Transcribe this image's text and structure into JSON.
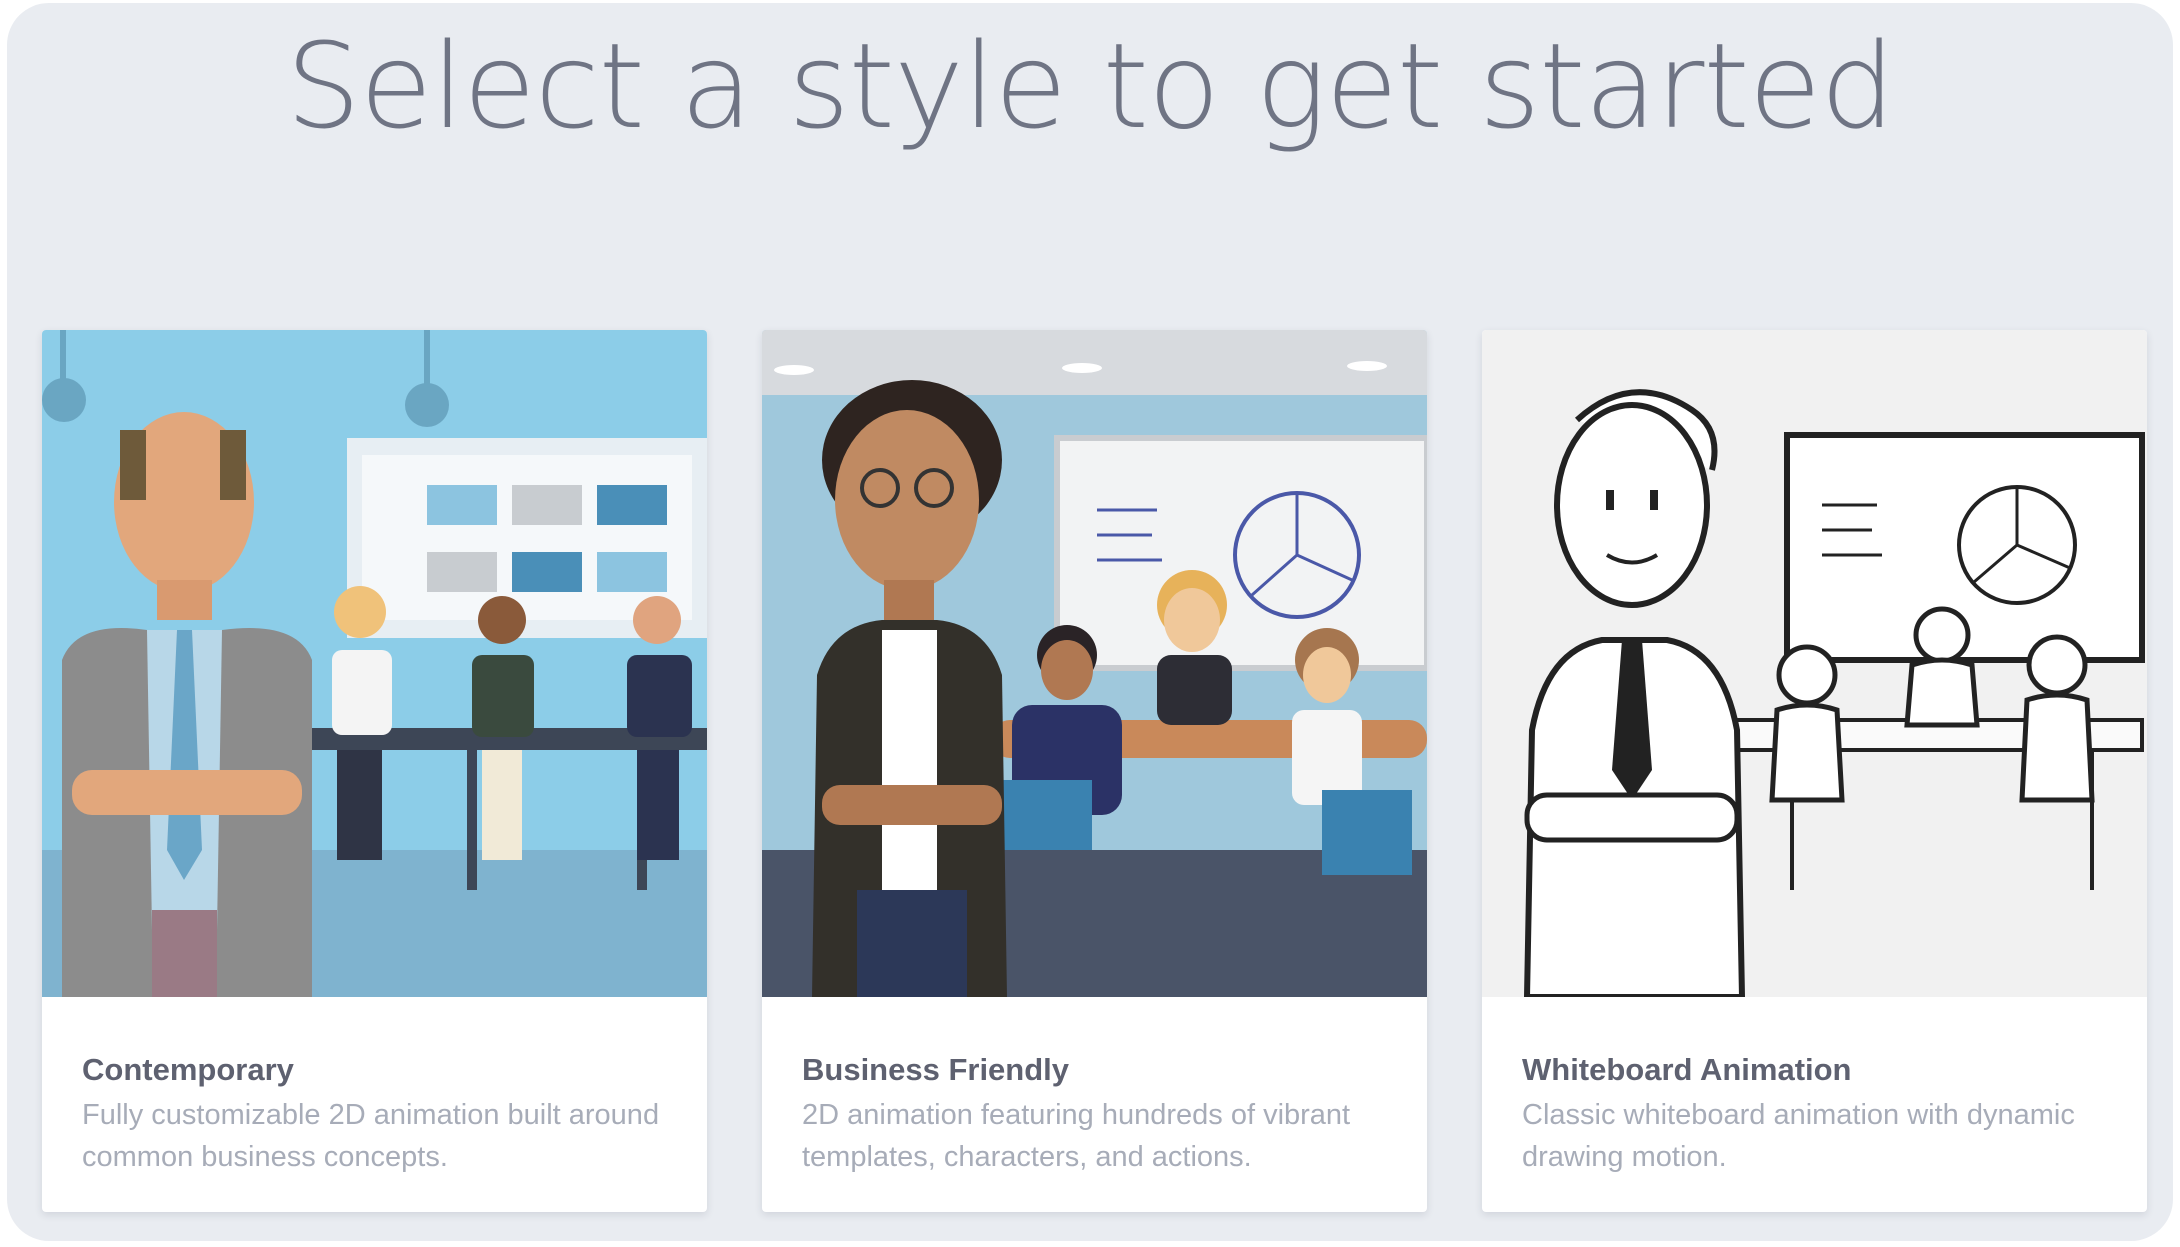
{
  "page": {
    "title": "Select a style to get started"
  },
  "styles": [
    {
      "name": "Contemporary",
      "description": "Fully customizable 2D animation built around common business concepts.",
      "image_icon": "contemporary-office-illustration"
    },
    {
      "name": "Business Friendly",
      "description": "2D animation featuring hundreds of vibrant templates, characters, and actions.",
      "image_icon": "business-meeting-illustration"
    },
    {
      "name": "Whiteboard Animation",
      "description": "Classic whiteboard animation with dynamic drawing motion.",
      "image_icon": "whiteboard-sketch-illustration"
    }
  ],
  "colors": {
    "background": "#e9ecf1",
    "title": "#6f7484",
    "card_name": "#5e6170",
    "card_desc": "#a7acb8"
  }
}
